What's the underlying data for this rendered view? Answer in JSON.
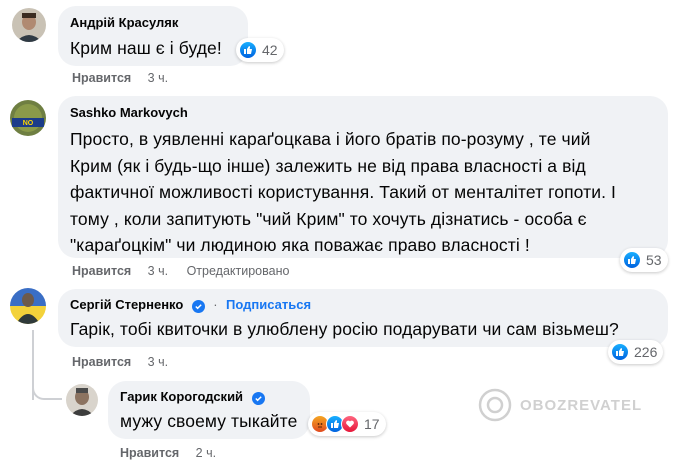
{
  "comments": [
    {
      "author": "Андрій Красуляк",
      "text": "Крим наш є і буде!",
      "like_label": "Нравится",
      "time": "3 ч.",
      "reaction_count": "42"
    },
    {
      "author": "Sashko Markovych",
      "text_lines": [
        "Просто, в уявленні караґоцкава і його братів по-розуму , те чий",
        "Крим (як і будь-що інше) залежить не від права власності а від",
        "фактичної можливості користування. Такий от менталітет гопоти. І",
        "тому , коли запитують \"чий Крим\" то хочуть дізнатись - особа є",
        "\"караґоцкім\" чи людиною яка поважає право власності !"
      ],
      "like_label": "Нравится",
      "time": "3 ч.",
      "edited": "Отредактировано",
      "reaction_count": "53"
    },
    {
      "author": "Сергій Стерненко",
      "follow": "Подписаться",
      "text": "Гарік, тобі квиточки в улюблену росію подарувати чи сам візьмеш?",
      "like_label": "Нравится",
      "time": "3 ч.",
      "reaction_count": "226"
    },
    {
      "author": "Гарик Корогодский",
      "text": "мужу своему тыкайте",
      "like_label": "Нравится",
      "time": "2 ч.",
      "reaction_count": "17"
    }
  ],
  "watermark": "OBOZREVATEL",
  "colors": {
    "bubble": "#f0f2f5",
    "meta": "#65676b",
    "link": "#1877f2"
  }
}
